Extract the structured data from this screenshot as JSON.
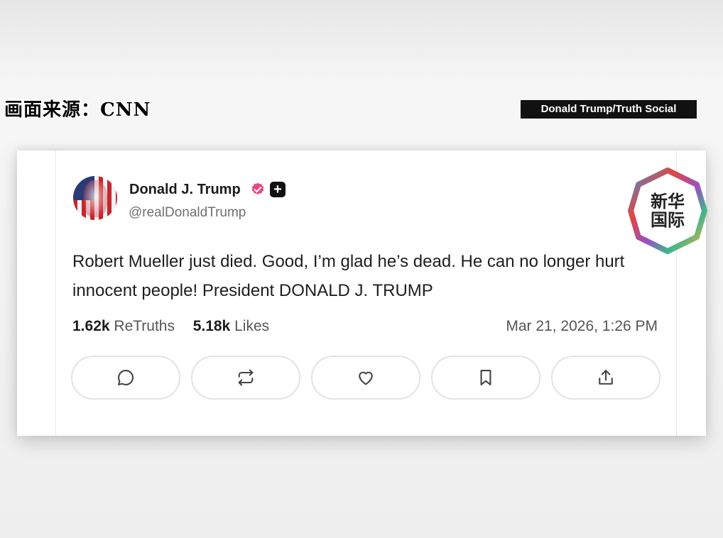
{
  "overlay": {
    "source_label": "画面来源：CNN",
    "credit": "Donald Trump/Truth Social"
  },
  "post": {
    "display_name": "Donald J. Trump",
    "handle": "@realDonaldTrump",
    "text": "Robert Mueller just died. Good, I’m glad he’s dead. He can no longer hurt innocent people! President DONALD J. TRUMP",
    "retruths_count": "1.62k",
    "retruths_label": "ReTruths",
    "likes_count": "5.18k",
    "likes_label": "Likes",
    "timestamp": "Mar 21, 2026, 1:26 PM",
    "verified_color": "#e84a7b",
    "plus_badge": "+"
  },
  "actions": [
    {
      "name": "reply",
      "icon": "comment-icon"
    },
    {
      "name": "retruth",
      "icon": "repost-icon"
    },
    {
      "name": "like",
      "icon": "heart-icon"
    },
    {
      "name": "bookmark",
      "icon": "bookmark-icon"
    },
    {
      "name": "share",
      "icon": "share-icon"
    }
  ],
  "logo": {
    "line1": "新华",
    "line2": "国际"
  }
}
